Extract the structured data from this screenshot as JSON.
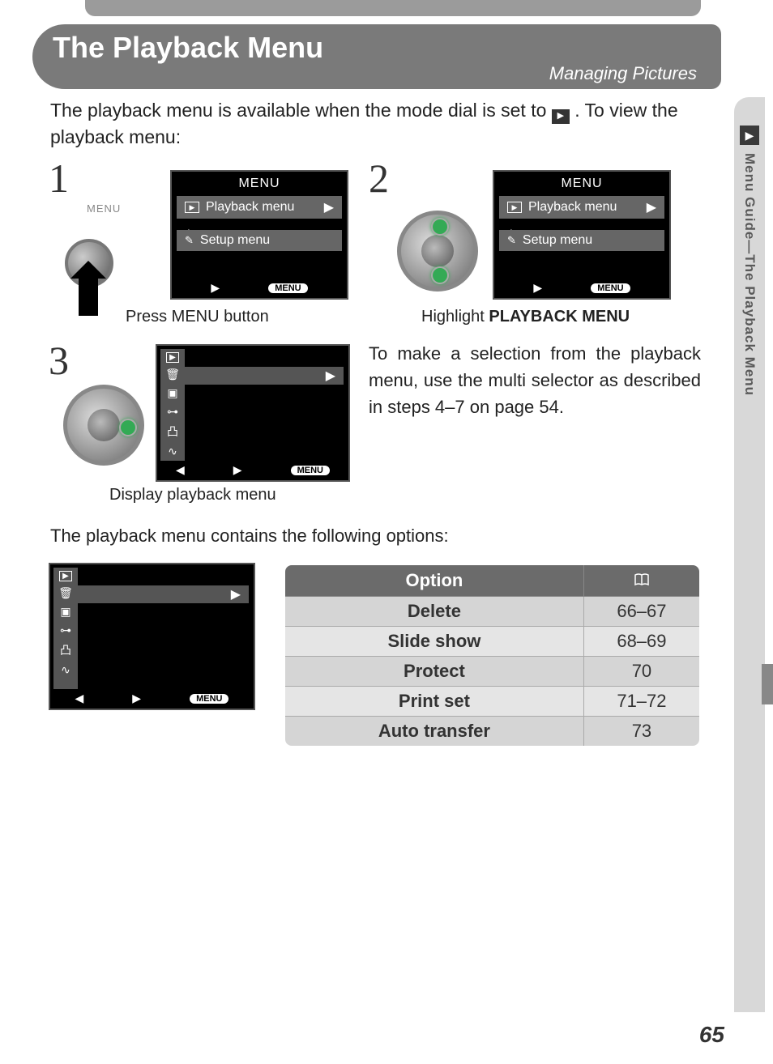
{
  "header": {
    "title": "The Playback Menu",
    "subtitle": "Managing Pictures"
  },
  "side_tab": "Menu Guide—The Playback Menu",
  "intro_pre": "The playback menu is available when the mode dial is set to ",
  "intro_post": ".  To view the playback menu:",
  "steps": {
    "s1": "1",
    "s2": "2",
    "s3": "3"
  },
  "lcd": {
    "menu_title": "MENU",
    "playback": "Playback menu",
    "setup": "Setup menu",
    "menu_pill": "MENU"
  },
  "cam_label": "MENU",
  "captions": {
    "c1": "Press MENU button",
    "c2_pre": "Highlight ",
    "c2_bold": "PLAYBACK MENU",
    "c3": "Display playback menu"
  },
  "body1": "To make a selection from the playback menu, use the multi selector as described in steps 4–7 on page 54.",
  "body2": "The playback menu contains the following options:",
  "table": {
    "head_option": "Option",
    "rows": [
      {
        "opt": "Delete",
        "page": "66–67"
      },
      {
        "opt": "Slide show",
        "page": "68–69"
      },
      {
        "opt": "Protect",
        "page": "70"
      },
      {
        "opt": "Print set",
        "page": "71–72"
      },
      {
        "opt": "Auto transfer",
        "page": "73"
      }
    ]
  },
  "page_number": "65"
}
